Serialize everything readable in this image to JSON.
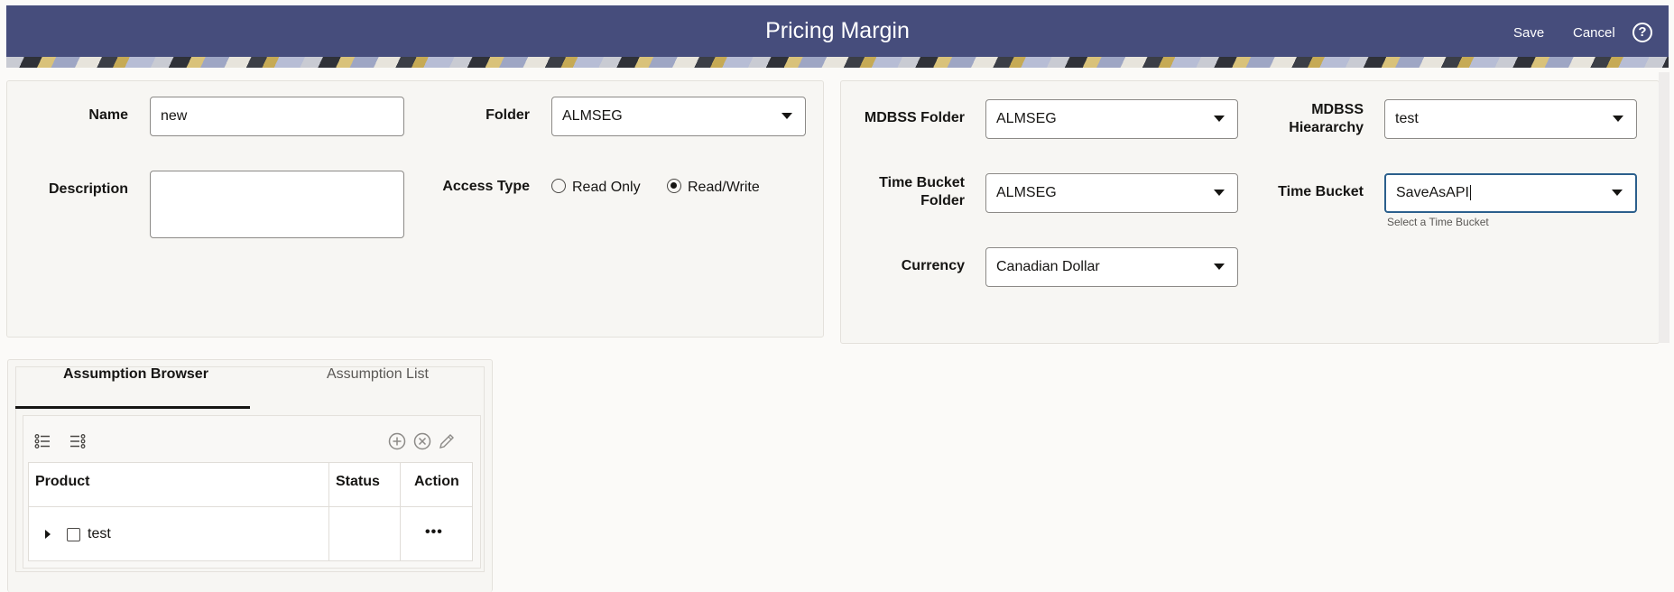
{
  "header": {
    "title": "Pricing Margin",
    "save_label": "Save",
    "cancel_label": "Cancel",
    "help_glyph": "?"
  },
  "left_form": {
    "name_label": "Name",
    "name_value": "new",
    "folder_label": "Folder",
    "folder_value": "ALMSEG",
    "description_label": "Description",
    "description_value": "",
    "access_type_label": "Access Type",
    "access_options": [
      "Read Only",
      "Read/Write"
    ],
    "access_selected": "Read/Write"
  },
  "right_form": {
    "mdbss_folder_label": "MDBSS Folder",
    "mdbss_folder_value": "ALMSEG",
    "mdbss_hierarchy_label_line1": "MDBSS",
    "mdbss_hierarchy_label_line2": "Hieararchy",
    "mdbss_hierarchy_value": "test",
    "time_bucket_folder_label_line1": "Time Bucket",
    "time_bucket_folder_label_line2": "Folder",
    "time_bucket_folder_value": "ALMSEG",
    "time_bucket_label": "Time Bucket",
    "time_bucket_value": "SaveAsAPI",
    "time_bucket_helper": "Select a Time Bucket",
    "currency_label": "Currency",
    "currency_value": "Canadian Dollar"
  },
  "assumptions": {
    "tabs": [
      "Assumption Browser",
      "Assumption List"
    ],
    "active_tab": "Assumption Browser",
    "columns": [
      "Product",
      "Status",
      "Action"
    ],
    "rows": [
      {
        "product": "test",
        "status": "",
        "action": "•••"
      }
    ]
  },
  "colors": {
    "header_bg": "#464d7c",
    "focus_border": "#2b5f8c"
  }
}
